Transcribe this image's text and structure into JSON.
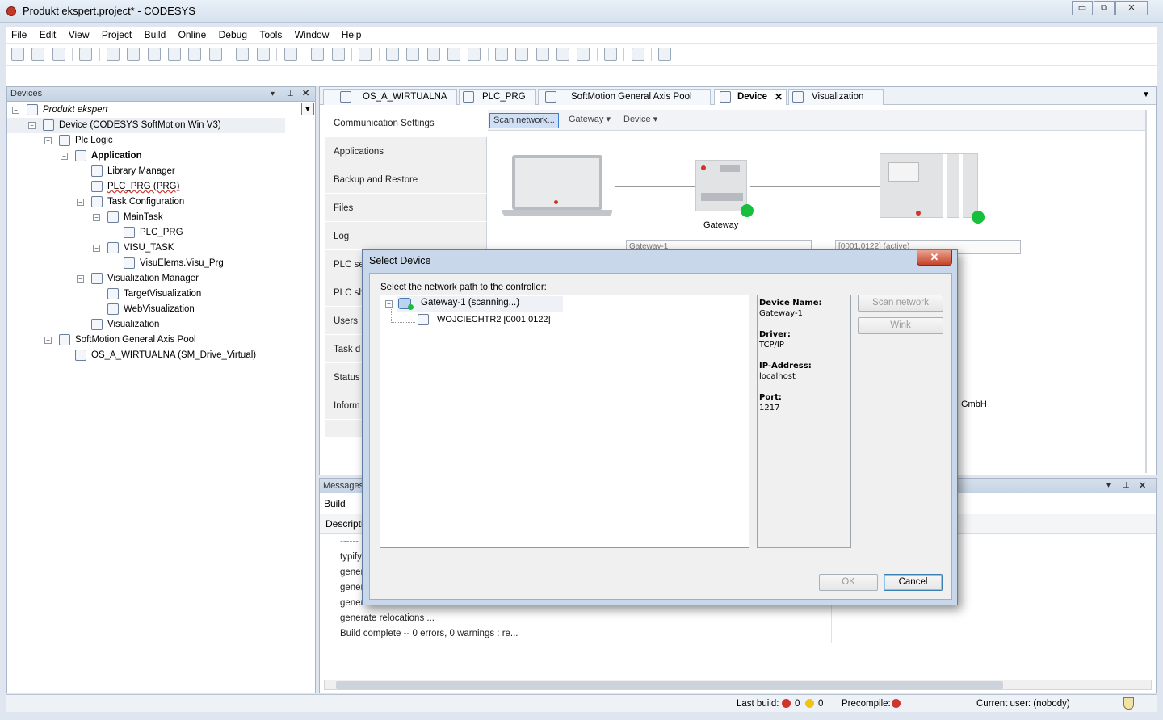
{
  "window": {
    "title": "Produkt ekspert.project* - CODESYS",
    "controls": [
      "▭",
      "⧉",
      "✕"
    ]
  },
  "menu": [
    "File",
    "Edit",
    "View",
    "Project",
    "Build",
    "Online",
    "Debug",
    "Tools",
    "Window",
    "Help"
  ],
  "devices_panel": {
    "title": "Devices",
    "tree": [
      {
        "label": "Produkt ekspert",
        "level": 0,
        "icon": "project-icon",
        "expander": "−",
        "italic": true
      },
      {
        "label": "Device (CODESYS SoftMotion Win V3)",
        "level": 1,
        "icon": "device-icon",
        "expander": "−",
        "highlight": true
      },
      {
        "label": "Plc Logic",
        "level": 2,
        "icon": "plc-logic-icon",
        "expander": "−"
      },
      {
        "label": "Application",
        "level": 3,
        "icon": "application-gear-icon",
        "expander": "−",
        "bold": true
      },
      {
        "label": "Library Manager",
        "level": 4,
        "icon": "library-manager-icon"
      },
      {
        "label": "PLC_PRG (PRG)",
        "level": 4,
        "icon": "program-icon",
        "underline": true
      },
      {
        "label": "Task Configuration",
        "level": 4,
        "icon": "task-configuration-icon",
        "expander": "−"
      },
      {
        "label": "MainTask",
        "level": 5,
        "icon": "task-icon",
        "expander": "−"
      },
      {
        "label": "PLC_PRG",
        "level": 6,
        "icon": "task-call-icon"
      },
      {
        "label": "VISU_TASK",
        "level": 5,
        "icon": "task-icon",
        "expander": "−"
      },
      {
        "label": "VisuElems.Visu_Prg",
        "level": 6,
        "icon": "task-call-icon"
      },
      {
        "label": "Visualization Manager",
        "level": 4,
        "icon": "visualization-manager-icon",
        "expander": "−"
      },
      {
        "label": "TargetVisualization",
        "level": 5,
        "icon": "target-visualization-icon"
      },
      {
        "label": "WebVisualization",
        "level": 5,
        "icon": "web-visualization-icon"
      },
      {
        "label": "Visualization",
        "level": 4,
        "icon": "visualization-icon"
      },
      {
        "label": "SoftMotion General Axis Pool",
        "level": 2,
        "icon": "axis-pool-icon",
        "expander": "−"
      },
      {
        "label": "OS_A_WIRTUALNA (SM_Drive_Virtual)",
        "level": 3,
        "icon": "drive-icon"
      }
    ]
  },
  "editor": {
    "tabs": [
      {
        "label": "OS_A_WIRTUALNA",
        "icon": "drive-icon",
        "active": false
      },
      {
        "label": "PLC_PRG",
        "icon": "program-icon",
        "active": false
      },
      {
        "label": "SoftMotion General Axis Pool",
        "icon": "axis-pool-icon",
        "active": false
      },
      {
        "label": "Device",
        "icon": "device-icon",
        "active": true,
        "closable": "✕"
      },
      {
        "label": "Visualization",
        "icon": "visualization-icon",
        "active": false
      }
    ],
    "sub_nav": [
      {
        "label": "Communication Settings",
        "selected": true
      },
      {
        "label": "Applications"
      },
      {
        "label": "Backup and Restore"
      },
      {
        "label": "Files"
      },
      {
        "label": "Log"
      },
      {
        "label": "PLC se"
      },
      {
        "label": "PLC sh"
      },
      {
        "label": "Users"
      },
      {
        "label": "Task d"
      },
      {
        "label": "Status"
      },
      {
        "label": "Inform"
      }
    ],
    "comm_toolbar": {
      "scan": "Scan network...",
      "gateway": "Gateway",
      "device": "Device",
      "caret": "▾"
    },
    "diagram": {
      "gateway_label": "Gateway",
      "gateway_select": "Gateway-1",
      "device_select": "[0001.0122] (active)",
      "ip_hint": "IP-Address:",
      "device_name_hint": "Device Name:",
      "vendor_tail": "GmbH"
    }
  },
  "messages": {
    "title": "Messages",
    "build": "Build",
    "column": "Descripti",
    "rows": [
      "------",
      "typify",
      "gener",
      "gener",
      "gener",
      "generate relocations ...",
      "Build complete -- 0 errors, 0 warnings : re..."
    ]
  },
  "status_bar": {
    "last_build_label": "Last build:",
    "errors": "0",
    "warnings": "0",
    "precompile_label": "Precompile:",
    "current_user": "Current user: (nobody)"
  },
  "dialog": {
    "title": "Select Device",
    "close": "✕",
    "prompt": "Select the network path to the controller:",
    "tree": [
      {
        "label": "Gateway-1 (scanning...)",
        "icon": "gateway-network-icon",
        "expander": "−"
      },
      {
        "label": "WOJCIECHTR2 [0001.0122]",
        "icon": "device-icon"
      }
    ],
    "info": {
      "device_name_label": "Device Name:",
      "device_name": "Gateway-1",
      "driver_label": "Driver:",
      "driver": "TCP/IP",
      "ip_label": "IP-Address:",
      "ip": "localhost",
      "port_label": "Port:",
      "port": "1217"
    },
    "buttons": {
      "scan_network": "Scan network",
      "wink": "Wink",
      "ok": "OK",
      "cancel": "Cancel"
    }
  },
  "colors": {
    "accent_blue": "#3b7bd1",
    "status_green": "#17c03c",
    "error_red": "#d0352d",
    "warning_yellow": "#f1c40f"
  }
}
